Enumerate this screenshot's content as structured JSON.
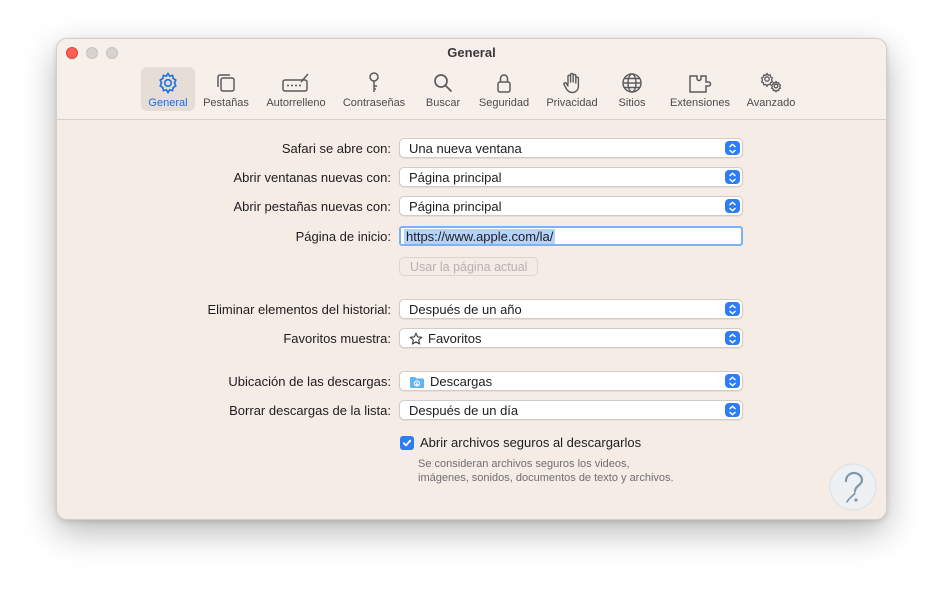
{
  "window": {
    "title": "General"
  },
  "toolbar": {
    "tabs": [
      {
        "label": "General",
        "icon": "gear-icon",
        "active": true
      },
      {
        "label": "Pestañas",
        "icon": "tabs-icon"
      },
      {
        "label": "Autorrelleno",
        "icon": "autofill-icon"
      },
      {
        "label": "Contraseñas",
        "icon": "key-icon"
      },
      {
        "label": "Buscar",
        "icon": "search-icon"
      },
      {
        "label": "Seguridad",
        "icon": "lock-icon"
      },
      {
        "label": "Privacidad",
        "icon": "hand-icon"
      },
      {
        "label": "Sitios",
        "icon": "globe-icon"
      },
      {
        "label": "Extensiones",
        "icon": "puzzle-icon"
      },
      {
        "label": "Avanzado",
        "icon": "gears-icon"
      }
    ]
  },
  "settings": {
    "opens_with": {
      "label": "Safari se abre con:",
      "value": "Una nueva ventana"
    },
    "new_windows": {
      "label": "Abrir ventanas nuevas con:",
      "value": "Página principal"
    },
    "new_tabs": {
      "label": "Abrir pestañas nuevas con:",
      "value": "Página principal"
    },
    "homepage": {
      "label": "Página de inicio:",
      "value": "https://www.apple.com/la/"
    },
    "use_current_page": "Usar la página actual",
    "remove_history": {
      "label": "Eliminar elementos del historial:",
      "value": "Después de un año"
    },
    "favorites_shows": {
      "label": "Favoritos muestra:",
      "value": "Favoritos"
    },
    "download_location": {
      "label": "Ubicación de las descargas:",
      "value": "Descargas"
    },
    "remove_downloads": {
      "label": "Borrar descargas de la lista:",
      "value": "Después de un día"
    },
    "open_safe_files": {
      "label": "Abrir archivos seguros al descargarlos",
      "checked": true,
      "help": "Se consideran archivos seguros los videos, imágenes, sonidos, documentos de texto y archivos."
    }
  },
  "colors": {
    "accent": "#2f7df6",
    "window_bg": "#f5ece6",
    "close": "#ff5f57"
  }
}
